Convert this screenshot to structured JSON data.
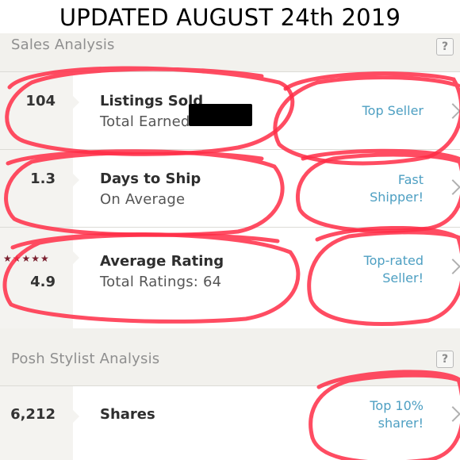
{
  "banner": "UPDATED AUGUST 24th 2019",
  "sales": {
    "title": "Sales Analysis",
    "help": "?",
    "rows": [
      {
        "value": "104",
        "title": "Listings Sold",
        "sub": "Total Earned",
        "badge_line1": "Top Seller",
        "badge_line2": ""
      },
      {
        "value": "1.3",
        "title": "Days to Ship",
        "sub": "On Average",
        "badge_line1": "Fast",
        "badge_line2": "Shipper!"
      },
      {
        "value": "4.9",
        "title": "Average Rating",
        "sub": "Total Ratings: 64",
        "badge_line1": "Top-rated",
        "badge_line2": "Seller!",
        "stars": "★★★★★"
      }
    ]
  },
  "stylist": {
    "title": "Posh Stylist Analysis",
    "help": "?",
    "rows": [
      {
        "value": "6,212",
        "title": "Shares",
        "badge_line1": "Top 10%",
        "badge_line2": "sharer!"
      }
    ]
  },
  "colors": {
    "accent": "#4d9fc2",
    "star": "#7a1e2e",
    "scribble": "#ff2d46",
    "header_bg": "#f2f1ed"
  }
}
